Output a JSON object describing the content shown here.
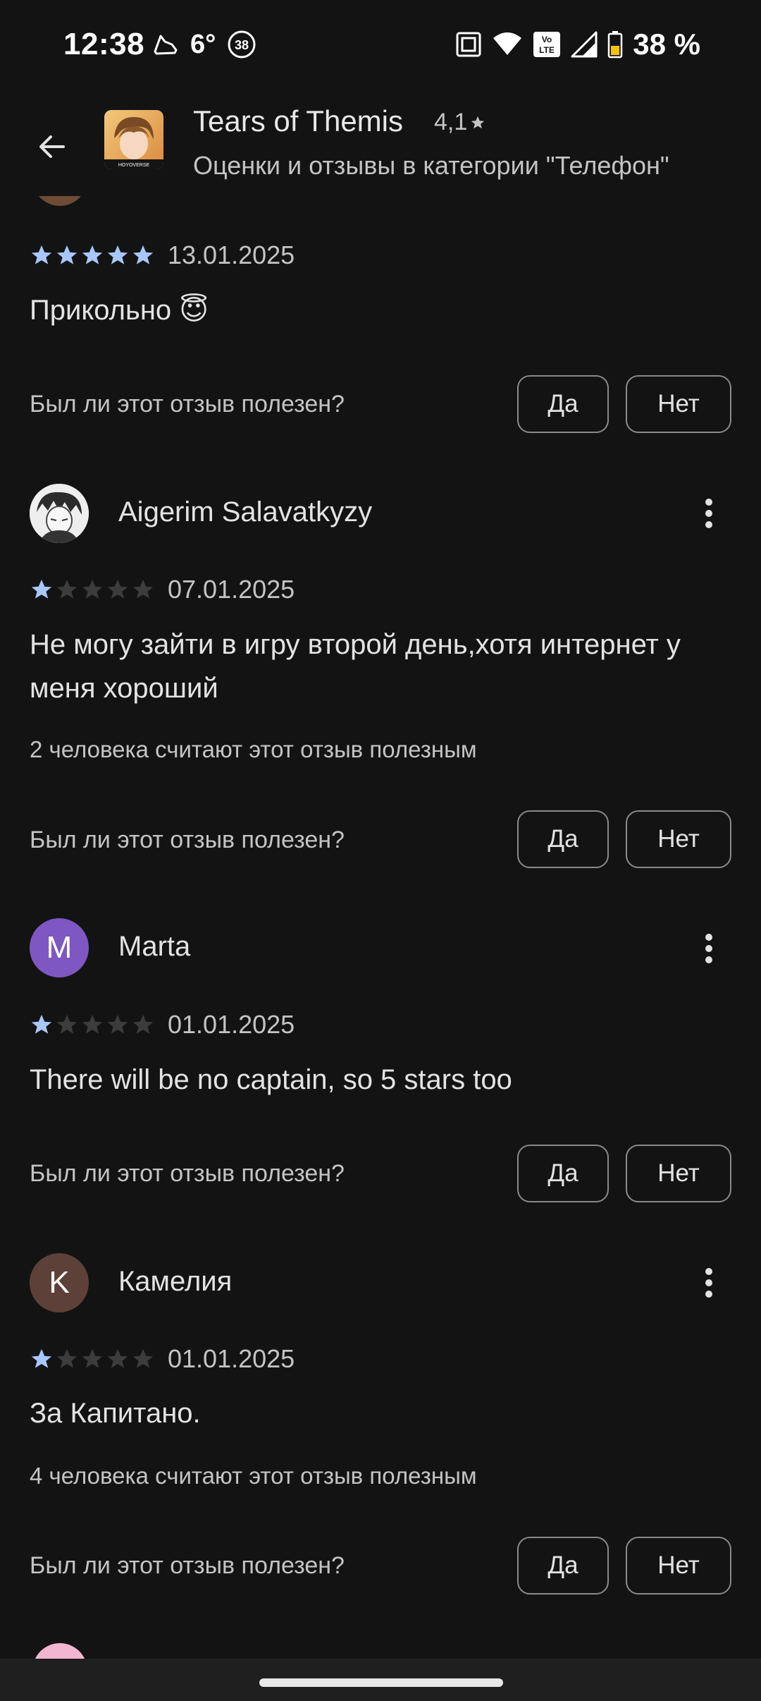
{
  "status_bar": {
    "time": "12:38",
    "temperature": "6°",
    "badge": "38",
    "battery": "38 %",
    "icons": [
      "running-shoe-icon",
      "nfc-icon",
      "wifi-icon",
      "volte-icon",
      "signal-icon",
      "battery-icon"
    ]
  },
  "header": {
    "app_name": "Tears of Themis",
    "rating": "4,1",
    "subtitle": "Оценки и отзывы в категории \"Телефон\"",
    "icon_caption": "HOYOVERSE"
  },
  "colors": {
    "background": "#131313",
    "star_filled": "#a8c7fa",
    "star_empty": "#3c3c3c",
    "avatar_marta": "#7e57c2",
    "avatar_kamelia": "#5d4037"
  },
  "reviews": [
    {
      "name": "",
      "rating": 5,
      "date": "13.01.2025",
      "text": "Прикольно 😇",
      "helpful_count": "",
      "helpful_question": "Был ли этот отзыв полезен?",
      "yes": "Да",
      "no": "Нет"
    },
    {
      "name": "Aigerim Salavatkyzy",
      "avatar_letter": "",
      "rating": 1,
      "date": "07.01.2025",
      "text": "Не могу зайти в игру второй день,хотя интернет у меня хороший",
      "helpful_count": "2 человека считают этот отзыв полезным",
      "helpful_question": "Был ли этот отзыв полезен?",
      "yes": "Да",
      "no": "Нет"
    },
    {
      "name": "Marta",
      "avatar_letter": "M",
      "rating": 1,
      "date": "01.01.2025",
      "text": "There will be no captain, so 5 stars too",
      "helpful_count": "",
      "helpful_question": "Был ли этот отзыв полезен?",
      "yes": "Да",
      "no": "Нет"
    },
    {
      "name": "Камелия",
      "avatar_letter": "K",
      "rating": 1,
      "date": "01.01.2025",
      "text": "За Капитано.",
      "helpful_count": "4 человека считают этот отзыв полезным",
      "helpful_question": "Был ли этот отзыв полезен?",
      "yes": "Да",
      "no": "Нет"
    }
  ]
}
